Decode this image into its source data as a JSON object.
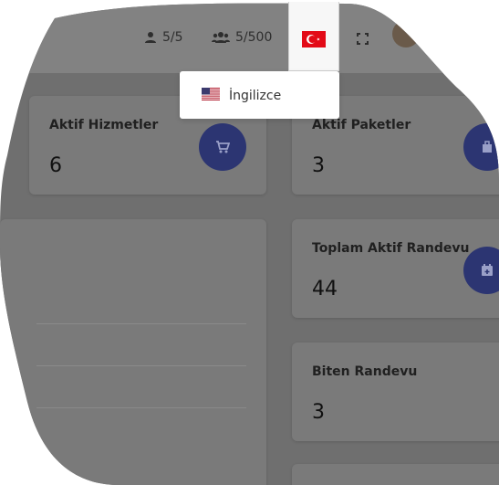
{
  "header": {
    "staff_count": "5/5",
    "customer_count": "5/500",
    "language_current_flag": "tr-flag"
  },
  "language_menu": {
    "items": [
      {
        "label": "İngilizce",
        "flag": "us-flag"
      }
    ]
  },
  "cards": {
    "active_services": {
      "title": "Aktif Hizmetler",
      "value": "6",
      "icon": "cart-icon"
    },
    "active_packages": {
      "title": "Aktif Paketler",
      "value": "3",
      "icon": "package-icon"
    },
    "total_active_appointments": {
      "title": "Toplam Aktif Randevu",
      "value": "44",
      "icon": "calendar-plus-icon"
    },
    "finished_appointments": {
      "title": "Biten Randevu",
      "value": "3"
    }
  },
  "colors": {
    "icon_circle": "#2c3572",
    "overlay": "#6f6f6f"
  }
}
